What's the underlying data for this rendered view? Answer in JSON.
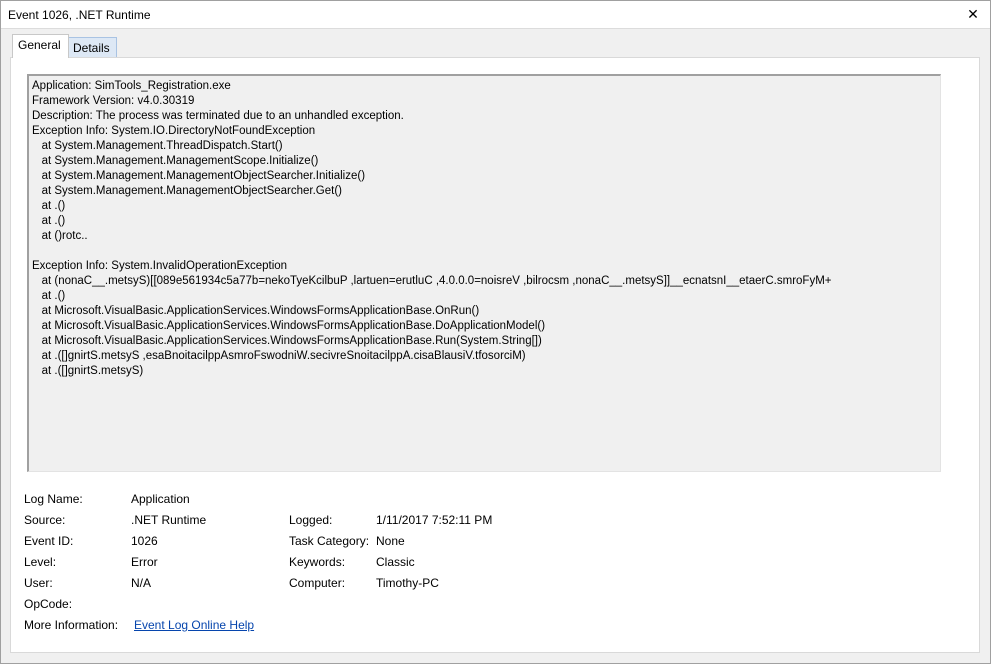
{
  "window": {
    "title": "Event 1026, .NET Runtime",
    "close_label": "✕"
  },
  "tabs": [
    {
      "label": "General"
    },
    {
      "label": "Details"
    }
  ],
  "description": [
    "Application: SimTools_Registration.exe",
    "Framework Version: v4.0.30319",
    "Description: The process was terminated due to an unhandled exception.",
    "Exception Info: System.IO.DirectoryNotFoundException",
    "   at System.Management.ThreadDispatch.Start()",
    "   at System.Management.ManagementScope.Initialize()",
    "   at System.Management.ManagementObjectSearcher.Initialize()",
    "   at System.Management.ManagementObjectSearcher.Get()",
    "   at .()",
    "   at .()",
    "   at ()rotc..",
    "",
    "Exception Info: System.InvalidOperationException",
    "   at (nonaC__.metsyS)[[089e561934c5a77b=nekoTyeKcilbuP ,lartuen=erutluC ,4.0.0.0=noisreV ,bilrocsm ,nonaC__.metsyS]]__ecnatsnI__etaerC.smroFyM+",
    "   at .()",
    "   at Microsoft.VisualBasic.ApplicationServices.WindowsFormsApplicationBase.OnRun()",
    "   at Microsoft.VisualBasic.ApplicationServices.WindowsFormsApplicationBase.DoApplicationModel()",
    "   at Microsoft.VisualBasic.ApplicationServices.WindowsFormsApplicationBase.Run(System.String[])",
    "   at .([]gnirtS.metsyS ,esaBnoitacilppAsmroFswodniW.secivreSnoitacilppA.cisaBlausiV.tfosorciM)",
    "   at .([]gnirtS.metsyS)"
  ],
  "properties": {
    "log_name_label": "Log Name:",
    "log_name": "Application",
    "source_label": "Source:",
    "source": ".NET Runtime",
    "logged_label": "Logged:",
    "logged": "1/11/2017 7:52:11 PM",
    "event_id_label": "Event ID:",
    "event_id": "1026",
    "task_category_label": "Task Category:",
    "task_category": "None",
    "level_label": "Level:",
    "level": "Error",
    "keywords_label": "Keywords:",
    "keywords": "Classic",
    "user_label": "User:",
    "user": "N/A",
    "computer_label": "Computer:",
    "computer": "Timothy-PC",
    "opcode_label": "OpCode:",
    "opcode": "",
    "more_info_label": "More Information:",
    "more_info_link": "Event Log Online Help"
  }
}
